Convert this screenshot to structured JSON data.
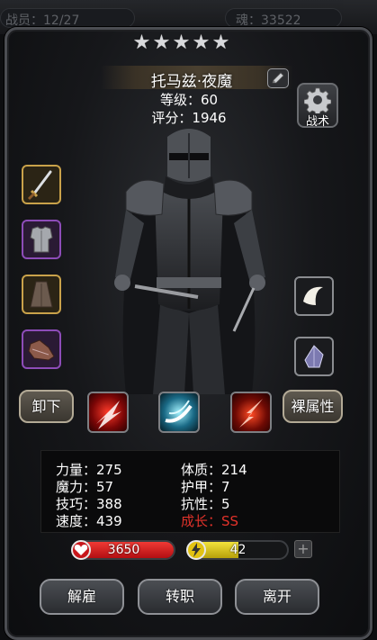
{
  "topbar": {
    "left_text": "战员：12/27",
    "right_text": "魂：33522"
  },
  "hero": {
    "stars": [
      "★",
      "★",
      "★",
      "★",
      "★"
    ],
    "name": "托马兹·夜魔",
    "level": "等级：60",
    "score": "评分：1946"
  },
  "tactics": {
    "label": "战术",
    "icon": "gear-icon"
  },
  "equipment_left": [
    {
      "icon": "dagger-icon",
      "rarity": "gold"
    },
    {
      "icon": "chest-armor-icon",
      "rarity": "purple"
    },
    {
      "icon": "cloak-icon",
      "rarity": "gold"
    },
    {
      "icon": "boots-icon",
      "rarity": "purple"
    }
  ],
  "equipment_right": [
    {
      "icon": "crescent-charm-icon"
    },
    {
      "icon": "crystal-shard-icon"
    }
  ],
  "buttons": {
    "unequip": "卸下",
    "naked_stats": "裸属性",
    "dismiss": "解雇",
    "change_class": "转职",
    "leave": "离开"
  },
  "skills": [
    {
      "icon": "red-slash-skill-icon"
    },
    {
      "icon": "cyan-whirl-skill-icon"
    },
    {
      "icon": "crimson-strike-skill-icon"
    }
  ],
  "stats": {
    "strength": "力量：275",
    "magic": "魔力：57",
    "skill": "技巧：388",
    "speed": "速度：439",
    "constitution": "体质：214",
    "armor": "护甲：7",
    "resistance": "抗性：5",
    "growth": "成长：SS"
  },
  "bars": {
    "hp": {
      "value": "3650",
      "fill_fraction": 1.0,
      "color": "#d9161b",
      "icon": "heart-icon"
    },
    "energy": {
      "value": "42",
      "fill_fraction": 0.5,
      "color": "#e8d417",
      "icon": "lightning-icon"
    }
  },
  "plus_label": "+",
  "colors": {
    "gold_frame": "#c9a24a",
    "purple_frame": "#8d4cb8",
    "highlight_red": "#e0322a"
  }
}
